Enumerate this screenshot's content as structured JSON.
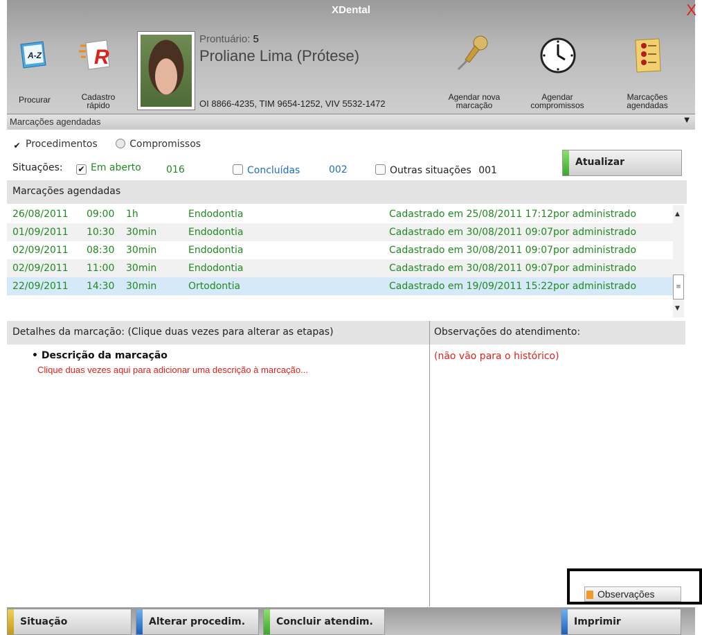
{
  "window": {
    "title": "XDental",
    "close": "X"
  },
  "toolbar": {
    "search_label": "Procurar",
    "quick_register_label": "Cadastro rápido",
    "new_appointment_label": "Agendar nova marcação",
    "schedule_commitments_label": "Agendar compromissos",
    "scheduled_label": "Marcações agendadas"
  },
  "patient": {
    "record_label": "Prontuário:",
    "record_number": "5",
    "name": "Proliane Lima (Prótese)",
    "phones": "OI 8866-4235, TIM 9654-1252, VIV 5532-1472"
  },
  "section": {
    "title": "Marcações agendadas"
  },
  "filters": {
    "procedures_label": "Procedimentos",
    "commitments_label": "Compromissos",
    "situations_label": "Situações:",
    "open_label": "Em aberto",
    "open_count": "016",
    "done_label": "Concluídas",
    "done_count": "002",
    "other_label": "Outras situações",
    "other_count": "001",
    "refresh_label": "Atualizar"
  },
  "appointments": {
    "header": "Marcações agendadas",
    "rows": [
      {
        "date": "26/08/2011",
        "time": "09:00",
        "duration": "1h",
        "procedure": "Endodontia",
        "registered": "Cadastrado em 25/08/2011 17:12por administrado"
      },
      {
        "date": "01/09/2011",
        "time": "10:30",
        "duration": "30min",
        "procedure": "Endodontia",
        "registered": "Cadastrado em 30/08/2011 09:07por administrado"
      },
      {
        "date": "02/09/2011",
        "time": "08:30",
        "duration": "30min",
        "procedure": "Endodontia",
        "registered": "Cadastrado em 30/08/2011 09:07por administrado"
      },
      {
        "date": "02/09/2011",
        "time": "11:00",
        "duration": "30min",
        "procedure": "Endodontia",
        "registered": "Cadastrado em 30/08/2011 09:07por administrado"
      },
      {
        "date": "22/09/2011",
        "time": "14:30",
        "duration": "30min",
        "procedure": "Ortodontia",
        "registered": "Cadastrado em 19/09/2011 15:22por administrado"
      }
    ]
  },
  "details": {
    "header": "Detalhes da marcação: (Clique duas vezes para alterar as etapas)",
    "bullet": "• Descrição da marcação",
    "hint": "Clique duas vezes aqui para adicionar uma descrição à marcação..."
  },
  "observations": {
    "header": "Observações do atendimento:",
    "note": "(não vão para o histórico)",
    "button": "Observações"
  },
  "footer": {
    "situation": "Situação",
    "change_proc": "Alterar procedim.",
    "finish": "Concluir atendim.",
    "print": "Imprimir"
  },
  "colors": {
    "green": "#1f8a1f",
    "blue": "#1e6fc2",
    "red": "#e0201a",
    "selected": "#d6e9f8"
  }
}
